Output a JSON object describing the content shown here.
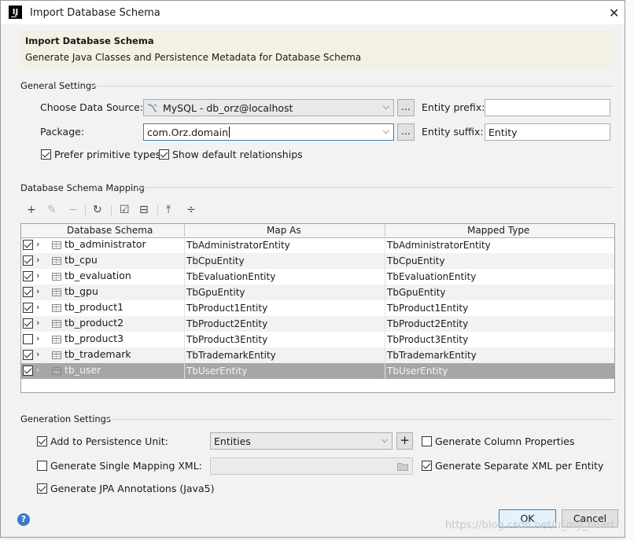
{
  "window": {
    "title": "Import Database Schema",
    "close_glyph": "✕",
    "app_icon_text": "IJ"
  },
  "banner": {
    "heading": "Import Database Schema",
    "description": "Generate Java Classes and Persistence Metadata for Database Schema"
  },
  "general_settings": {
    "title": "General Settings",
    "data_source_label": "Choose Data Source:",
    "data_source_value": "MySQL - db_orz@localhost",
    "browse_label": "...",
    "package_label": "Package:",
    "package_value": "com.Orz.domain",
    "entity_prefix_label": "Entity prefix:",
    "entity_prefix_value": "",
    "entity_suffix_label": "Entity suffix:",
    "entity_suffix_value": "Entity",
    "prefer_primitive_label": "Prefer primitive types",
    "prefer_primitive_checked": true,
    "show_relationships_label": "Show default relationships",
    "show_relationships_checked": true
  },
  "mapping": {
    "title": "Database Schema Mapping",
    "toolbar": [
      "add-icon",
      "edit-icon",
      "remove-icon",
      "refresh-icon",
      "check-all-icon",
      "uncheck-all-icon",
      "expand-all-icon",
      "collapse-all-icon"
    ],
    "columns": [
      "Database Schema",
      "Map As",
      "Mapped Type"
    ],
    "rows": [
      {
        "checked": true,
        "schema": "tb_administrator",
        "map_as": "TbAdministratorEntity",
        "mapped_type": "TbAdministratorEntity"
      },
      {
        "checked": true,
        "schema": "tb_cpu",
        "map_as": "TbCpuEntity",
        "mapped_type": "TbCpuEntity"
      },
      {
        "checked": true,
        "schema": "tb_evaluation",
        "map_as": "TbEvaluationEntity",
        "mapped_type": "TbEvaluationEntity"
      },
      {
        "checked": true,
        "schema": "tb_gpu",
        "map_as": "TbGpuEntity",
        "mapped_type": "TbGpuEntity"
      },
      {
        "checked": true,
        "schema": "tb_product1",
        "map_as": "TbProduct1Entity",
        "mapped_type": "TbProduct1Entity"
      },
      {
        "checked": true,
        "schema": "tb_product2",
        "map_as": "TbProduct2Entity",
        "mapped_type": "TbProduct2Entity"
      },
      {
        "checked": false,
        "schema": "tb_product3",
        "map_as": "TbProduct3Entity",
        "mapped_type": "TbProduct3Entity"
      },
      {
        "checked": true,
        "schema": "tb_trademark",
        "map_as": "TbTrademarkEntity",
        "mapped_type": "TbTrademarkEntity"
      },
      {
        "checked": true,
        "schema": "tb_user",
        "map_as": "TbUserEntity",
        "mapped_type": "TbUserEntity",
        "selected": true
      }
    ]
  },
  "generation_settings": {
    "title": "Generation Settings",
    "add_persistence_label": "Add to Persistence Unit:",
    "add_persistence_checked": true,
    "persistence_unit_value": "Entities",
    "add_unit_glyph": "+",
    "gen_column_props_label": "Generate Column Properties",
    "gen_column_props_checked": false,
    "gen_single_xml_label": "Generate Single Mapping XML:",
    "gen_single_xml_checked": false,
    "gen_separate_xml_label": "Generate Separate XML per Entity",
    "gen_separate_xml_checked": true,
    "gen_jpa_label": "Generate JPA Annotations (Java5)",
    "gen_jpa_checked": true
  },
  "footer": {
    "help_glyph": "?",
    "ok_label": "OK",
    "cancel_label": "Cancel"
  },
  "watermark": "https://blog.csdn.net/u_my_heart",
  "colors": {
    "banner_bg": "#f3f1e3",
    "selection_bg": "#a6a6a6",
    "focus_border": "#3c7fb1",
    "help_blue": "#3c78c8"
  }
}
